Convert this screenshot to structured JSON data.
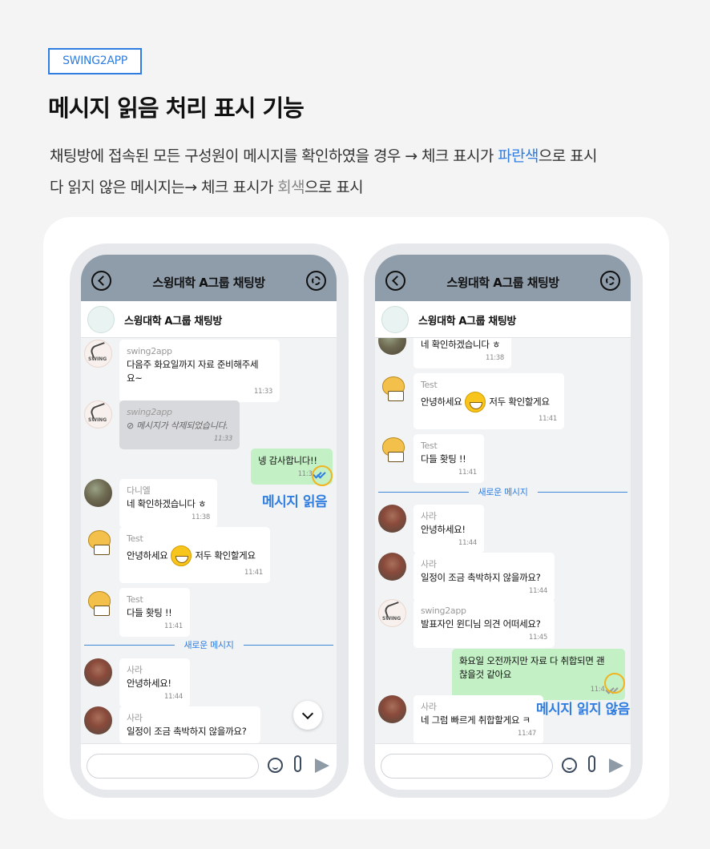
{
  "header": {
    "tag": "SWING2APP",
    "title": "메시지 읽음 처리 표시 기능",
    "line1_a": "채팅방에 접속된 모든 구성원이 메시지를 확인하였을 경우 → 체크 표시가 ",
    "line1_blue": "파란색",
    "line1_b": "으로 표시",
    "line2_a": "다 읽지 않은 메시지는→ 체크 표시가 ",
    "line2_gray": "회색",
    "line2_b": "으로 표시"
  },
  "callouts": {
    "read": "메시지 읽음",
    "unread": "메시지 읽지 않음"
  },
  "colors": {
    "accent": "#2f7de1",
    "topbar": "#8f9dab",
    "mine_bubble": "#c3f0c4",
    "ring": "#f2b320"
  },
  "left": {
    "topbar_title": "스윙대학 A그룹 채팅방",
    "room_name": "스윙대학 A그룹 채팅방",
    "messages": [
      {
        "sender": "swing2app",
        "text1": "다음주 화요일까지 자료 준비해주세",
        "text2": "요~",
        "time": "11:33"
      },
      {
        "sender": "swing2app",
        "text": "⊘  메시지가 삭제되었습니다.",
        "time": "11:33"
      },
      {
        "text": "넹 감사합니다!!",
        "time": "11:3"
      },
      {
        "sender": "다니엘",
        "text": "네 확인하겠습니다 ㅎ",
        "time": "11:38"
      },
      {
        "sender": "Test",
        "text_a": "안녕하세요",
        "text_b": "저두 확인할게요",
        "time": "11:41"
      },
      {
        "sender": "Test",
        "text": "다들 홧팅 !!",
        "time": "11:41"
      },
      {
        "sender": "사라",
        "text": "안녕하세요!",
        "time": "11:44"
      },
      {
        "sender": "사라",
        "text": "일정이 조금 촉박하지 않을까요?"
      }
    ],
    "divider": "새로운 메시지"
  },
  "right": {
    "topbar_title": "스윙대학 A그룹 채팅방",
    "room_name": "스윙대학 A그룹 채팅방",
    "messages": [
      {
        "text": "네 확인하겠습니다 ㅎ",
        "time": "11:38"
      },
      {
        "sender": "Test",
        "text_a": "안녕하세요",
        "text_b": "저두 확인할게요",
        "time": "11:41"
      },
      {
        "sender": "Test",
        "text": "다들 홧팅 !!",
        "time": "11:41"
      },
      {
        "sender": "사라",
        "text": "안녕하세요!",
        "time": "11:44"
      },
      {
        "sender": "사라",
        "text": "일정이 조금 촉박하지 않을까요?",
        "time": "11:44"
      },
      {
        "sender": "swing2app",
        "text": "발표자인 윈디님 의견 어떠세요?",
        "time": "11:45"
      },
      {
        "text1": "화요일 오전까지만 자료 다 취합되면 괜",
        "text2": "찮을것 같아요",
        "time": "11:4"
      },
      {
        "sender": "사라",
        "text": "네 그럼 빠르게 취합할게요 ㅋ",
        "time": "11:47"
      }
    ],
    "divider": "새로운 메시지"
  }
}
